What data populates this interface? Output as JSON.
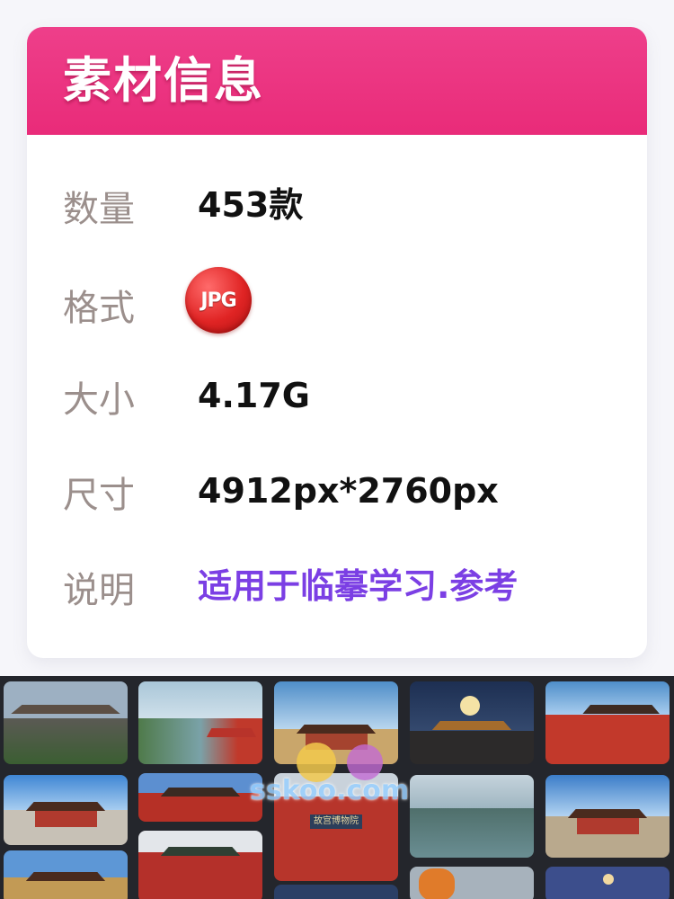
{
  "card": {
    "title": "素材信息",
    "colors": {
      "header": "#ea2f7d",
      "label": "#9b8f8c",
      "value": "#111111",
      "accent_value": "#7b3fe4"
    },
    "rows": [
      {
        "label": "数量",
        "value": "453款"
      },
      {
        "label": "格式",
        "value": "JPG",
        "icon": "jpg-badge-icon"
      },
      {
        "label": "大小",
        "value": "4.17G"
      },
      {
        "label": "尺寸",
        "value": "4912px*2760px"
      },
      {
        "label": "说明",
        "value": "适用于临摹学习.参考"
      }
    ]
  },
  "gallery": {
    "watermark": "sskoo.com",
    "thumbnail_count": 15,
    "plaque_text": "故宫博物院"
  }
}
